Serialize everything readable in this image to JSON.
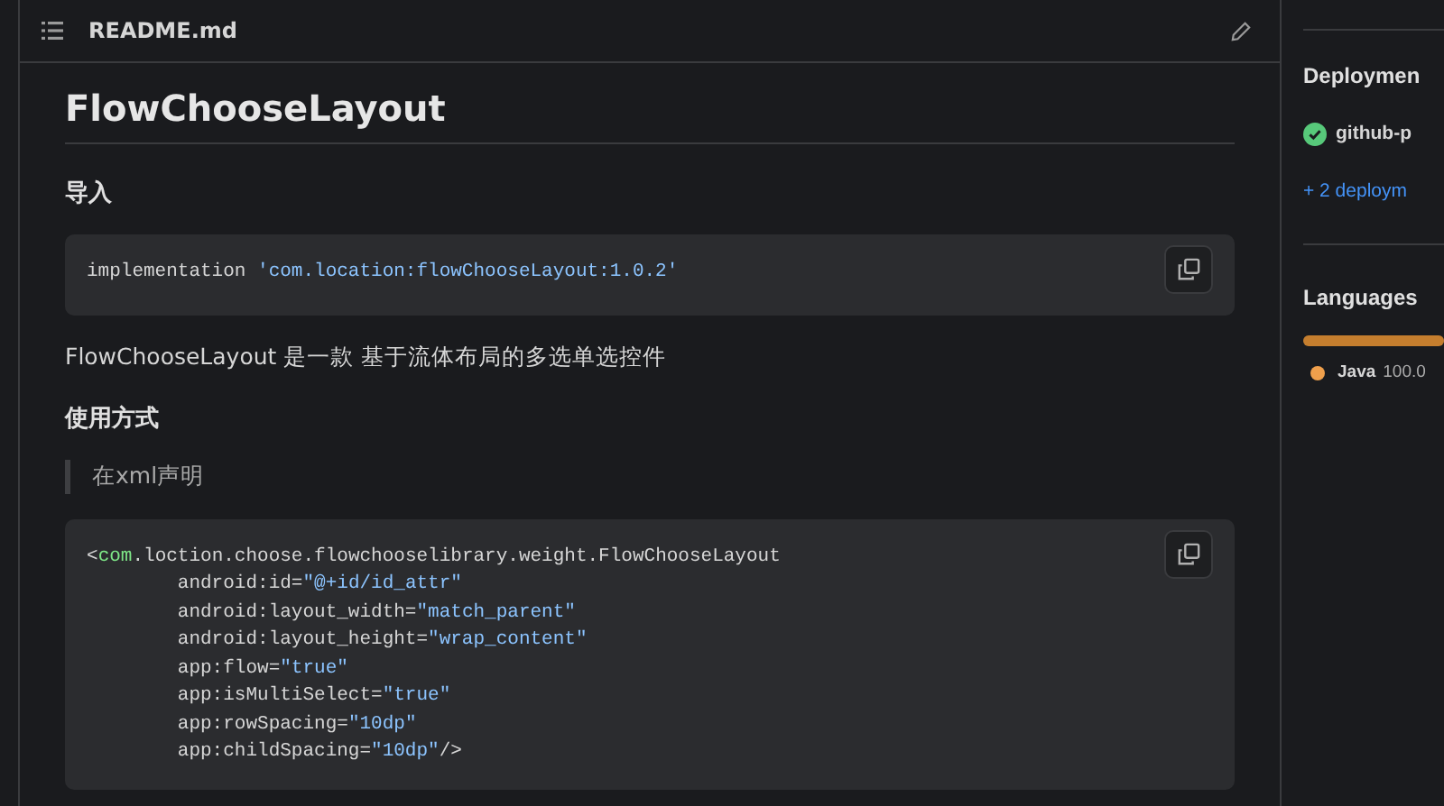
{
  "readme": {
    "filename": "README.md",
    "title": "FlowChooseLayout",
    "blocks": [
      {
        "kind": "heading",
        "text": "导入"
      },
      {
        "kind": "code",
        "lines": [
          [
            {
              "kind": "plain",
              "text": "implementation "
            },
            {
              "kind": "string",
              "text": "'com.location:flowChooseLayout:1.0.2'"
            }
          ]
        ]
      },
      {
        "kind": "paragraph",
        "text": "FlowChooseLayout 是一款 基于流体布局的多选单选控件"
      },
      {
        "kind": "heading",
        "text": "使用方式"
      },
      {
        "kind": "quote",
        "text": "在xml声明"
      },
      {
        "kind": "code",
        "lines": [
          [
            {
              "kind": "plain",
              "text": "<"
            },
            {
              "kind": "tag",
              "text": "com"
            },
            {
              "kind": "plain",
              "text": ".loction.choose.flowchooselibrary.weight.FlowChooseLayout"
            }
          ],
          [
            {
              "kind": "plain",
              "text": "        android:id="
            },
            {
              "kind": "string",
              "text": "\"@+id/id_attr\""
            }
          ],
          [
            {
              "kind": "plain",
              "text": "        android:layout_width="
            },
            {
              "kind": "string",
              "text": "\"match_parent\""
            }
          ],
          [
            {
              "kind": "plain",
              "text": "        android:layout_height="
            },
            {
              "kind": "string",
              "text": "\"wrap_content\""
            }
          ],
          [
            {
              "kind": "plain",
              "text": "        app:flow="
            },
            {
              "kind": "string",
              "text": "\"true\""
            }
          ],
          [
            {
              "kind": "plain",
              "text": "        app:isMultiSelect="
            },
            {
              "kind": "string",
              "text": "\"true\""
            }
          ],
          [
            {
              "kind": "plain",
              "text": "        app:rowSpacing="
            },
            {
              "kind": "string",
              "text": "\"10dp\""
            }
          ],
          [
            {
              "kind": "plain",
              "text": "        app:childSpacing="
            },
            {
              "kind": "string",
              "text": "\"10dp\""
            },
            {
              "kind": "plain",
              "text": "/>"
            }
          ]
        ]
      }
    ]
  },
  "sidebar": {
    "deployments": {
      "heading": "Deploymen",
      "items": [
        {
          "name": "github-p",
          "succeeded": true
        }
      ],
      "more_link": "+ 2 deploym"
    },
    "languages": {
      "heading": "Languages",
      "bar": {
        "level": 1.0
      },
      "items": [
        {
          "name": "Java",
          "percent": "100.0",
          "color": "#f0a04c"
        }
      ]
    }
  }
}
